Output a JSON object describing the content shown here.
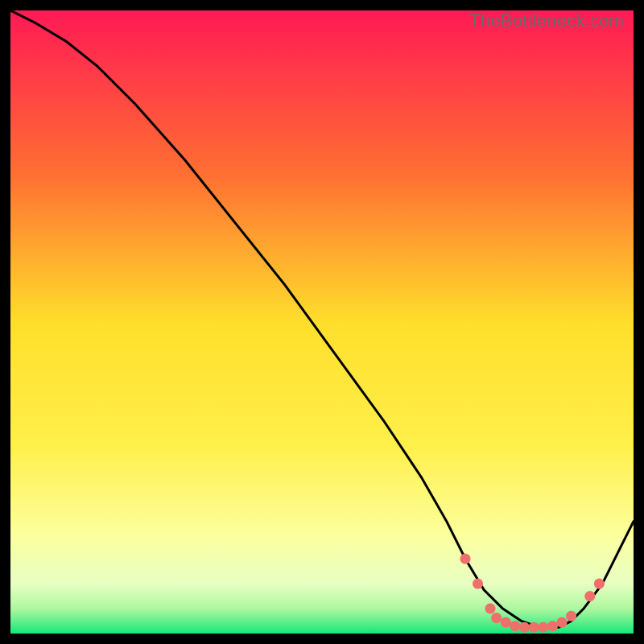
{
  "watermark": "TheBottleneck.com",
  "colors": {
    "top": "#ff1a55",
    "mid_upper": "#ff8b2a",
    "mid": "#ffde2b",
    "mid_lower": "#fff97a",
    "pale": "#f6ffd0",
    "green": "#17e879",
    "curve": "#000000",
    "dots": "#ef6f6b"
  },
  "chart_data": {
    "type": "line",
    "title": "",
    "xlabel": "",
    "ylabel": "",
    "xlim": [
      0,
      100
    ],
    "ylim": [
      0,
      100
    ],
    "series": [
      {
        "name": "curve",
        "x": [
          0,
          4,
          9,
          14,
          20,
          28,
          36,
          44,
          52,
          60,
          66,
          70,
          73,
          76,
          79,
          82,
          85,
          88,
          90,
          92,
          95,
          98,
          100
        ],
        "y": [
          100,
          98,
          95,
          91,
          85,
          76,
          66,
          56,
          45,
          34,
          25,
          18,
          12,
          7,
          4,
          2,
          1,
          1,
          2,
          4,
          8,
          14,
          18
        ]
      }
    ],
    "dot_clusters": [
      {
        "x": 73,
        "y": 12
      },
      {
        "x": 75,
        "y": 8
      },
      {
        "x": 77,
        "y": 4
      },
      {
        "x": 78,
        "y": 2.5
      },
      {
        "x": 79.5,
        "y": 1.8
      },
      {
        "x": 81,
        "y": 1.2
      },
      {
        "x": 82.5,
        "y": 1
      },
      {
        "x": 84,
        "y": 1
      },
      {
        "x": 85.5,
        "y": 1
      },
      {
        "x": 87,
        "y": 1.2
      },
      {
        "x": 88.5,
        "y": 1.8
      },
      {
        "x": 90,
        "y": 2.8
      },
      {
        "x": 93,
        "y": 6
      },
      {
        "x": 94.5,
        "y": 8
      }
    ]
  }
}
